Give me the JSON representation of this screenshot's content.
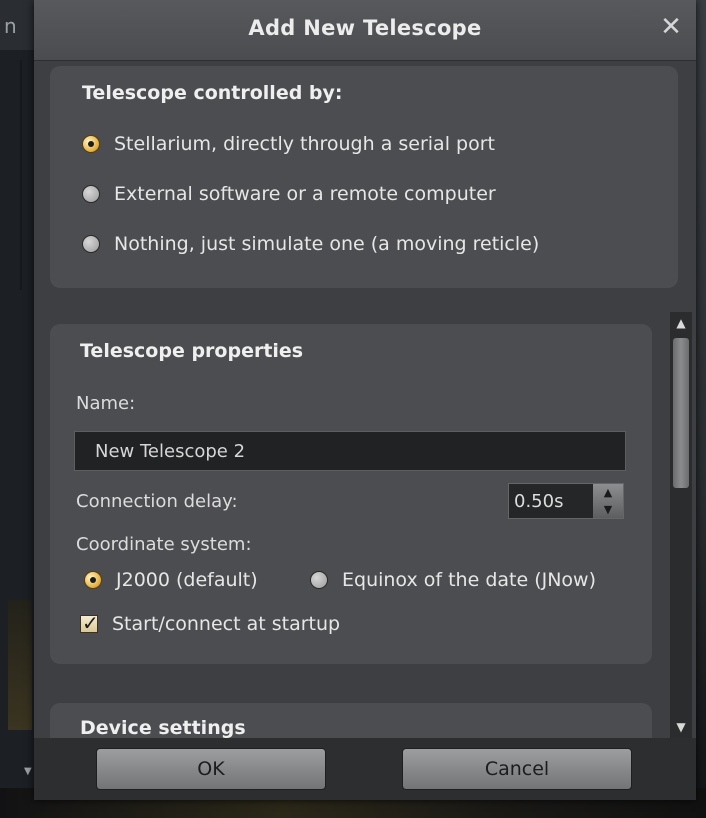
{
  "background": {
    "left_text": "n"
  },
  "dialog": {
    "title": "Add New Telescope",
    "close_glyph": "✕",
    "controlled_by": {
      "title": "Telescope controlled by:",
      "options": [
        {
          "label": "Stellarium, directly through a serial port",
          "selected": true
        },
        {
          "label": "External software or a remote computer",
          "selected": false
        },
        {
          "label": "Nothing, just simulate one (a moving reticle)",
          "selected": false
        }
      ]
    },
    "properties": {
      "title": "Telescope properties",
      "name_label": "Name:",
      "name_value": "New Telescope 2",
      "delay_label": "Connection delay:",
      "delay_value": "0.50s",
      "coord_label": "Coordinate system:",
      "coord_options": [
        {
          "label": "J2000 (default)",
          "selected": true
        },
        {
          "label": "Equinox of the date (JNow)",
          "selected": false
        }
      ],
      "startup_label": "Start/connect at startup",
      "startup_checked": true
    },
    "device": {
      "title": "Device settings"
    },
    "buttons": {
      "ok": "OK",
      "cancel": "Cancel"
    }
  },
  "colors": {
    "dialog_bg": "#3d3f42",
    "panel_bg": "#4b4d50",
    "accent_radio": "#e8b84a"
  },
  "icons": {
    "close": "close-icon",
    "spin_up": "chevron-up-icon",
    "spin_down": "chevron-down-icon",
    "scroll_up": "scroll-up-icon",
    "scroll_down": "scroll-down-icon"
  }
}
